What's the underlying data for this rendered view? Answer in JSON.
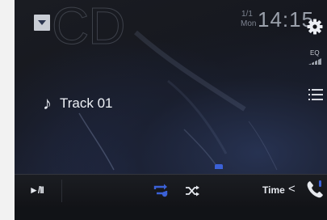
{
  "source": {
    "label": "CD",
    "dropdown_icon": "triangle-down-icon"
  },
  "status": {
    "date_numeric": "1/1",
    "day": "Mon",
    "time": "14:15"
  },
  "side_icons": {
    "settings": "gear-icon",
    "eq_label": "EQ",
    "list": "list-icon"
  },
  "track": {
    "icon": "music-note-icon",
    "note_glyph": "♪",
    "name": "Track 01"
  },
  "controls": {
    "play_pause": "►/II",
    "repeat": "repeat-icon",
    "shuffle": "shuffle-icon",
    "time_label": "Time",
    "time_chevron": "<",
    "phone": "phone-icon"
  },
  "colors": {
    "accent_blue": "#3b61d7",
    "background": "#111317",
    "text": "#e9ecf2"
  }
}
